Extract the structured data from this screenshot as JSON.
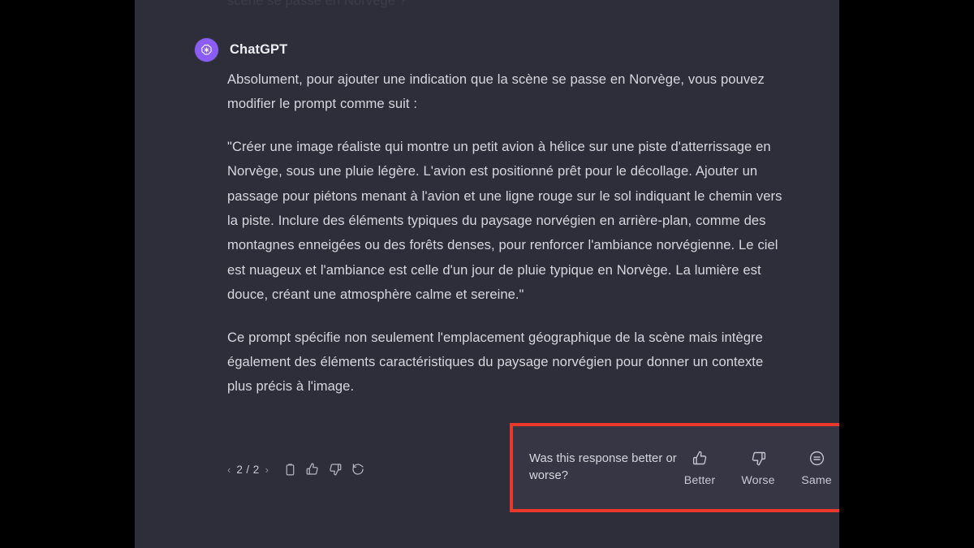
{
  "window": {
    "background_color": "#000000",
    "content_background": "#2e2e3a"
  },
  "clipped_previous_line": "scène se passe en Norvège ?",
  "message": {
    "author": "ChatGPT",
    "avatar_icon": "openai-logo-icon",
    "avatar_color": "#8b5cf6",
    "paragraphs": [
      "Absolument, pour ajouter une indication que la scène se passe en Norvège, vous pouvez modifier le prompt comme suit :",
      "\"Créer une image réaliste qui montre un petit avion à hélice sur une piste d'atterrissage en Norvège, sous une pluie légère. L'avion est positionné prêt pour le décollage. Ajouter un passage pour piétons menant à l'avion et une ligne rouge sur le sol indiquant le chemin vers la piste. Inclure des éléments typiques du paysage norvégien en arrière-plan, comme des montagnes enneigées ou des forêts denses, pour renforcer l'ambiance norvégienne. Le ciel est nuageux et l'ambiance est celle d'un jour de pluie typique en Norvège. La lumière est douce, créant une atmosphère calme et sereine.\"",
      "Ce prompt spécifie non seulement l'emplacement géographique de la scène mais intègre également des éléments caractéristiques du paysage norvégien pour donner un contexte plus précis à l'image."
    ]
  },
  "actions": {
    "prev_label": "‹",
    "next_label": "›",
    "page_count": "2 / 2",
    "buttons": [
      {
        "name": "copy-button",
        "icon": "clipboard-icon"
      },
      {
        "name": "thumbs-up-button",
        "icon": "thumbs-up-icon"
      },
      {
        "name": "thumbs-down-button",
        "icon": "thumbs-down-icon"
      },
      {
        "name": "regenerate-button",
        "icon": "refresh-icon"
      }
    ]
  },
  "feedback": {
    "question": "Was this response better or worse?",
    "highlight_color": "#e8392a",
    "panel_background": "#363644",
    "options": [
      {
        "label": "Better",
        "icon": "thumbs-up-icon"
      },
      {
        "label": "Worse",
        "icon": "thumbs-down-icon"
      },
      {
        "label": "Same",
        "icon": "circle-equals-icon"
      }
    ],
    "close_icon": "close-icon"
  }
}
